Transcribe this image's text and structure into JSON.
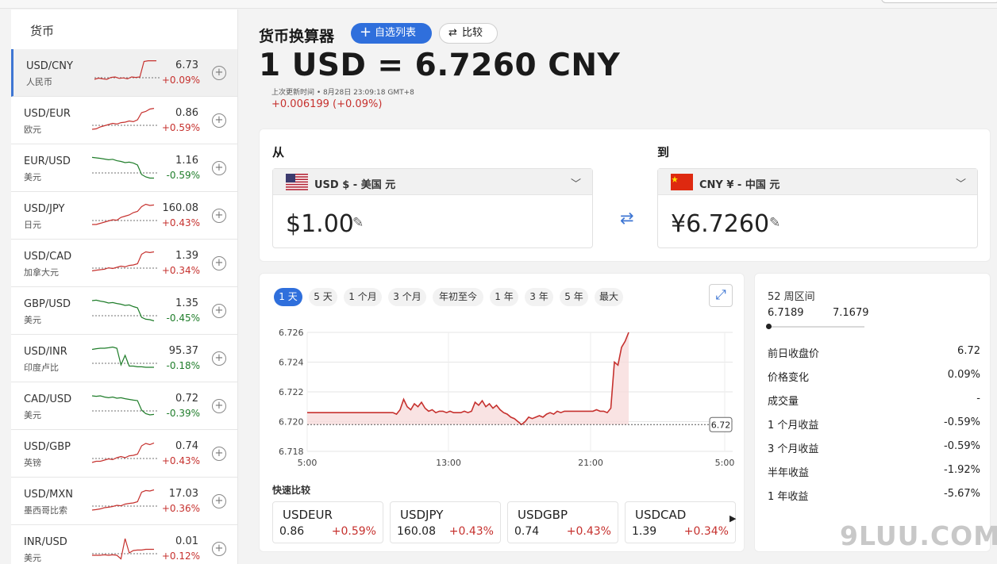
{
  "sidebar": {
    "title": "货币",
    "items": [
      {
        "pair": "USD/CNY",
        "sub": "人民币",
        "value": "6.73",
        "change": "+0.09%",
        "dir": "up",
        "spark": [
          0.2,
          0.25,
          0.22,
          0.2,
          0.28,
          0.3,
          0.24,
          0.26,
          0.22,
          0.3,
          0.28,
          0.3,
          0.95,
          0.98,
          0.98,
          0.98
        ],
        "selected": true
      },
      {
        "pair": "USD/EUR",
        "sub": "欧元",
        "value": "0.86",
        "change": "+0.59%",
        "dir": "up",
        "spark": [
          0.1,
          0.12,
          0.2,
          0.25,
          0.3,
          0.35,
          0.32,
          0.38,
          0.4,
          0.45,
          0.42,
          0.5,
          0.8,
          0.85,
          0.95,
          0.98
        ]
      },
      {
        "pair": "EUR/USD",
        "sub": "美元",
        "value": "1.16",
        "change": "-0.59%",
        "dir": "down",
        "spark": [
          0.92,
          0.9,
          0.88,
          0.85,
          0.82,
          0.84,
          0.78,
          0.75,
          0.7,
          0.72,
          0.68,
          0.6,
          0.2,
          0.1,
          0.05,
          0.05
        ]
      },
      {
        "pair": "USD/JPY",
        "sub": "日元",
        "value": "160.08",
        "change": "+0.43%",
        "dir": "up",
        "spark": [
          0.1,
          0.1,
          0.15,
          0.2,
          0.25,
          0.3,
          0.28,
          0.4,
          0.45,
          0.5,
          0.6,
          0.65,
          0.85,
          0.95,
          0.9,
          0.92
        ]
      },
      {
        "pair": "USD/CAD",
        "sub": "加拿大元",
        "value": "1.39",
        "change": "+0.34%",
        "dir": "up",
        "spark": [
          0.15,
          0.18,
          0.2,
          0.22,
          0.28,
          0.25,
          0.3,
          0.35,
          0.32,
          0.38,
          0.4,
          0.45,
          0.85,
          0.95,
          0.92,
          0.95
        ]
      },
      {
        "pair": "GBP/USD",
        "sub": "美元",
        "value": "1.35",
        "change": "-0.45%",
        "dir": "down",
        "spark": [
          0.9,
          0.92,
          0.88,
          0.85,
          0.8,
          0.82,
          0.78,
          0.75,
          0.7,
          0.72,
          0.65,
          0.6,
          0.2,
          0.12,
          0.1,
          0.05
        ]
      },
      {
        "pair": "USD/INR",
        "sub": "印度卢比",
        "value": "95.37",
        "change": "-0.18%",
        "dir": "down",
        "spark": [
          0.85,
          0.88,
          0.9,
          0.9,
          0.92,
          0.95,
          0.9,
          0.2,
          0.6,
          0.15,
          0.15,
          0.12,
          0.12,
          0.1,
          0.1,
          0.1
        ]
      },
      {
        "pair": "CAD/USD",
        "sub": "美元",
        "value": "0.72",
        "change": "-0.39%",
        "dir": "down",
        "spark": [
          0.9,
          0.88,
          0.9,
          0.85,
          0.82,
          0.85,
          0.8,
          0.82,
          0.78,
          0.75,
          0.72,
          0.7,
          0.3,
          0.15,
          0.1,
          0.12
        ]
      },
      {
        "pair": "USD/GBP",
        "sub": "英镑",
        "value": "0.74",
        "change": "+0.43%",
        "dir": "up",
        "spark": [
          0.1,
          0.15,
          0.15,
          0.2,
          0.25,
          0.22,
          0.3,
          0.35,
          0.3,
          0.38,
          0.4,
          0.45,
          0.8,
          0.9,
          0.85,
          0.92
        ]
      },
      {
        "pair": "USD/MXN",
        "sub": "墨西哥比索",
        "value": "17.03",
        "change": "+0.36%",
        "dir": "up",
        "spark": [
          0.1,
          0.12,
          0.15,
          0.2,
          0.22,
          0.25,
          0.3,
          0.28,
          0.35,
          0.38,
          0.4,
          0.45,
          0.85,
          0.92,
          0.9,
          0.95
        ]
      },
      {
        "pair": "INR/USD",
        "sub": "美元",
        "value": "0.01",
        "change": "+0.12%",
        "dir": "up",
        "spark": [
          0.2,
          0.2,
          0.2,
          0.22,
          0.2,
          0.22,
          0.2,
          0.05,
          0.9,
          0.3,
          0.4,
          0.42,
          0.42,
          0.45,
          0.45,
          0.45
        ]
      }
    ]
  },
  "header": {
    "title": "货币换算器",
    "watch_label": "自选列表",
    "compare_label": "比较",
    "rate_text": "1 USD = 6.7260 CNY",
    "updated": "上次更新时间 • 8月28日 23:09:18 GMT+8",
    "delta": "+0.006199 (+0.09%)"
  },
  "converter": {
    "from_label": "从",
    "to_label": "到",
    "from_currency": "USD $ - 美国 元",
    "to_currency": "CNY ¥ - 中国 元",
    "from_amount": "$1.00",
    "to_amount": "¥6.7260"
  },
  "ranges": [
    "1 天",
    "5 天",
    "1 个月",
    "3 个月",
    "年初至今",
    "1 年",
    "3 年",
    "5 年",
    "最大"
  ],
  "active_range": "1 天",
  "chart_data": {
    "type": "line",
    "x_ticks": [
      "5:00",
      "13:00",
      "21:00",
      "5:00"
    ],
    "y_ticks": [
      "6.726",
      "6.724",
      "6.722",
      "6.720",
      "6.718"
    ],
    "ylim": [
      6.718,
      6.726
    ],
    "prev_close": 6.7198,
    "prev_close_label": "6.72",
    "series": [
      {
        "values": [
          6.7206,
          6.7206,
          6.7206,
          6.7206,
          6.7206,
          6.7206,
          6.7206,
          6.7206,
          6.7206,
          6.7206,
          6.7206,
          6.7206,
          6.7206,
          6.7206,
          6.7206,
          6.7206,
          6.7206,
          6.7206,
          6.7206,
          6.7206,
          6.7206,
          6.7206,
          6.7206,
          6.7206,
          6.7206,
          6.7205,
          6.7208,
          6.7215,
          6.721,
          6.7208,
          6.7212,
          6.721,
          6.7213,
          6.7209,
          6.7207,
          6.7208,
          6.7206,
          6.7207,
          6.7207,
          6.7206,
          6.7207,
          6.7206,
          6.7206,
          6.7206,
          6.7207,
          6.7206,
          6.7207,
          6.7213,
          6.7211,
          6.7214,
          6.721,
          6.7212,
          6.7209,
          6.7211,
          6.7208,
          6.7206,
          6.7205,
          6.7203,
          6.7202,
          6.72,
          6.7198,
          6.72,
          6.7203,
          6.7202,
          6.7203,
          6.7204,
          6.7203,
          6.7205,
          6.7206,
          6.7205,
          6.7207,
          6.7206,
          6.7207,
          6.7207,
          6.7207,
          6.7207,
          6.7207,
          6.7207,
          6.7207,
          6.7207,
          6.7207,
          6.7208,
          6.7207,
          6.7207,
          6.7206,
          6.7209,
          6.724,
          6.7238,
          6.725,
          6.7254,
          6.726
        ],
        "color": "#c6312e"
      }
    ]
  },
  "quick_compare": {
    "title": "快速比较",
    "items": [
      {
        "name": "USDEUR",
        "value": "0.86",
        "change": "+0.59%"
      },
      {
        "name": "USDJPY",
        "value": "160.08",
        "change": "+0.43%"
      },
      {
        "name": "USDGBP",
        "value": "0.74",
        "change": "+0.43%"
      },
      {
        "name": "USDCAD",
        "value": "1.39",
        "change": "+0.34%"
      }
    ]
  },
  "stats": {
    "range_title": "52 周区间",
    "range_low": "6.7189",
    "range_high": "7.1679",
    "rows": [
      {
        "k": "前日收盘价",
        "v": "6.72"
      },
      {
        "k": "价格变化",
        "v": "0.09%"
      },
      {
        "k": "成交量",
        "v": "-"
      },
      {
        "k": "1 个月收益",
        "v": "-0.59%"
      },
      {
        "k": "3 个月收益",
        "v": "-0.59%"
      },
      {
        "k": "半年收益",
        "v": "-1.92%"
      },
      {
        "k": "1 年收益",
        "v": "-5.67%"
      }
    ]
  },
  "watermark": "9LUU.COM",
  "icons": {
    "add": "plus-icon",
    "compare": "swap-arrows-icon",
    "edit": "pencil-icon",
    "expand": "expand-icon",
    "dropdown": "chevron-down-icon"
  }
}
